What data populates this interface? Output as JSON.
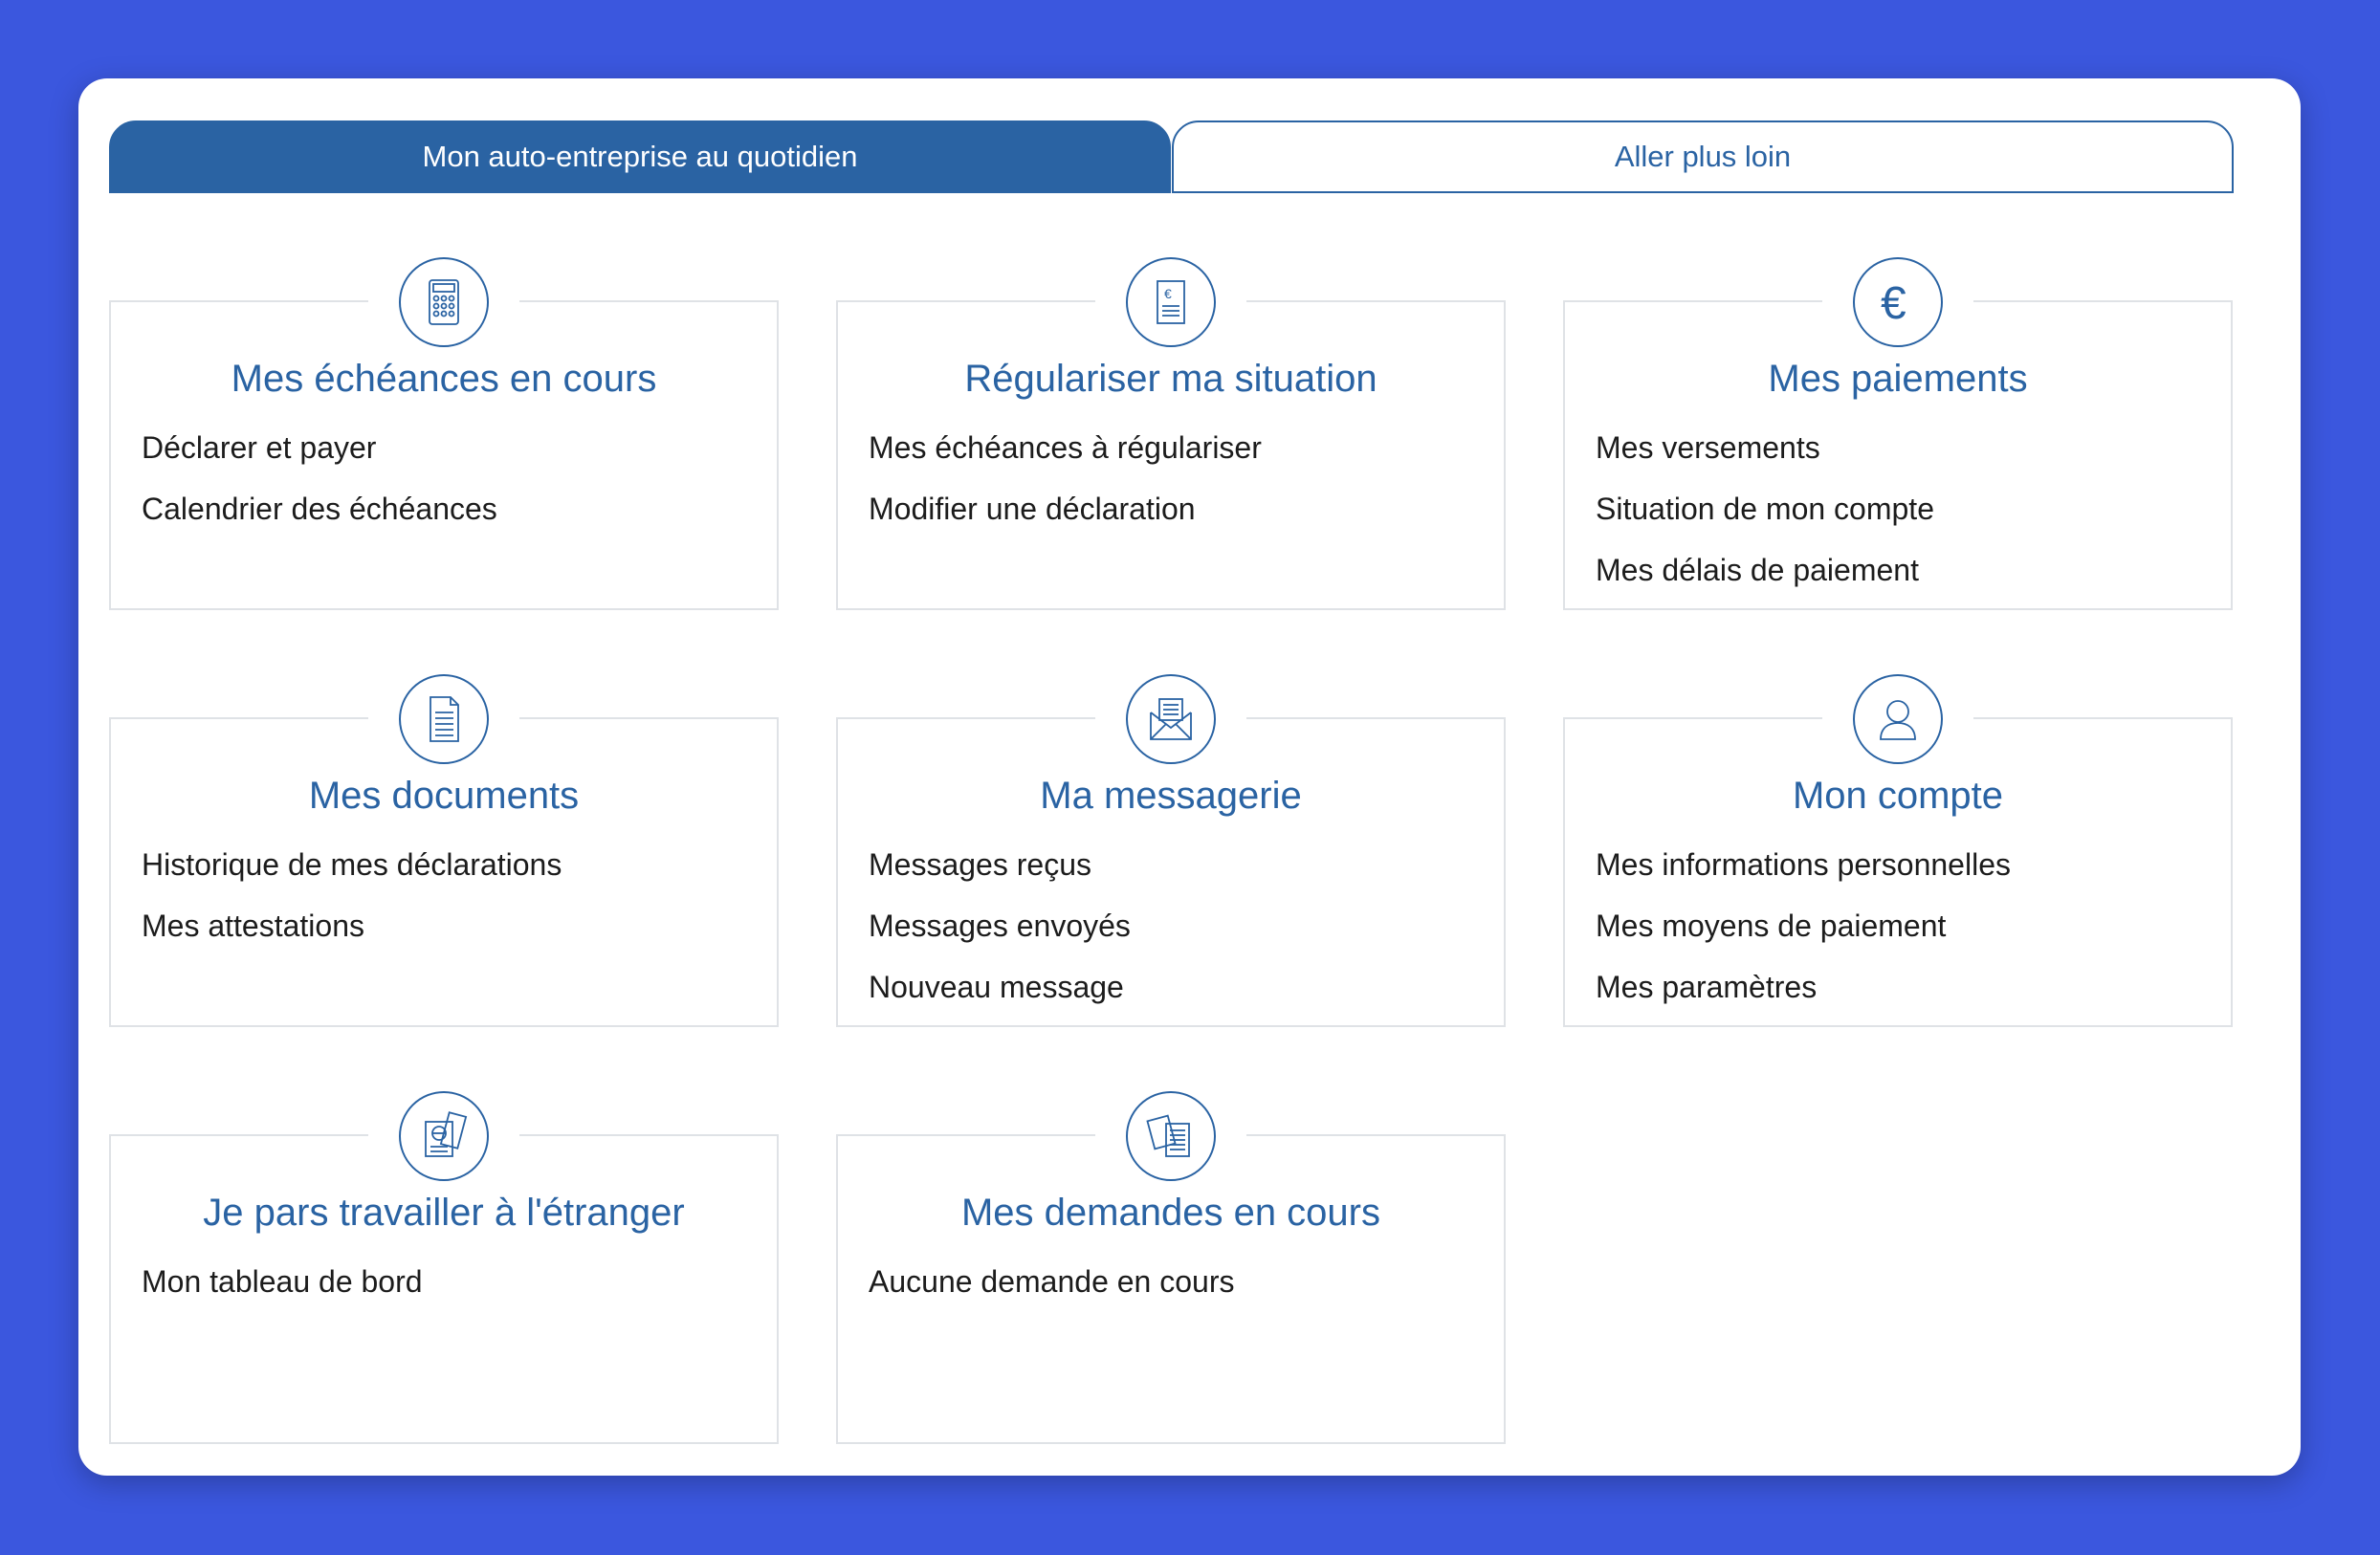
{
  "tabs": [
    {
      "label": "Mon auto-entreprise au quotidien",
      "active": true
    },
    {
      "label": "Aller plus loin",
      "active": false
    }
  ],
  "colors": {
    "background": "#3b57de",
    "accent": "#2a63a3",
    "card_border": "#dfe2e6"
  },
  "cards": [
    {
      "icon": "calculator-icon",
      "title": "Mes échéances en cours",
      "links": [
        "Déclarer et payer",
        "Calendrier des échéances"
      ]
    },
    {
      "icon": "euro-document-icon",
      "title": "Régulariser ma situation",
      "links": [
        "Mes échéances à régulariser",
        "Modifier une déclaration"
      ]
    },
    {
      "icon": "euro-icon",
      "title": "Mes paiements",
      "links": [
        "Mes versements",
        "Situation de mon compte",
        "Mes délais de paiement"
      ]
    },
    {
      "icon": "document-icon",
      "title": "Mes documents",
      "links": [
        "Historique de mes déclarations",
        "Mes attestations"
      ]
    },
    {
      "icon": "envelope-icon",
      "title": "Ma messagerie",
      "links": [
        "Messages reçus",
        "Messages envoyés",
        "Nouveau message"
      ]
    },
    {
      "icon": "user-icon",
      "title": "Mon compte",
      "links": [
        "Mes informations personnelles",
        "Mes moyens de paiement",
        "Mes paramètres"
      ]
    },
    {
      "icon": "passport-icon",
      "title": "Je pars travailler à l'étranger",
      "links": [
        "Mon tableau de bord"
      ]
    },
    {
      "icon": "documents-stack-icon",
      "title": "Mes demandes en cours",
      "links": [
        "Aucune demande en cours"
      ]
    }
  ]
}
